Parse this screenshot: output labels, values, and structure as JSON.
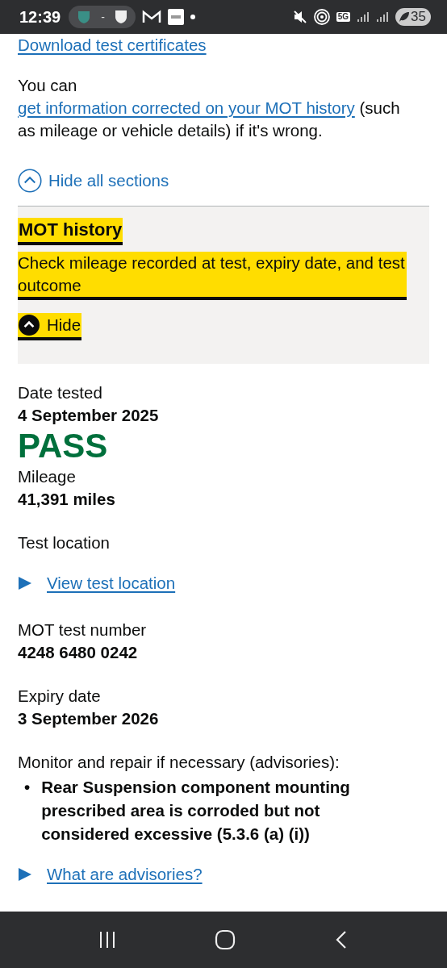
{
  "status_bar": {
    "time": "12:39",
    "separator": "-",
    "network": "5G",
    "battery": "35"
  },
  "download_link": "Download test certificates",
  "intro": {
    "before": "You can ",
    "link": "get information corrected on your MOT history",
    "after": " (such as mileage or vehicle details) if it's wrong."
  },
  "toggle_all": {
    "label": "Hide all sections",
    "expanded": true
  },
  "section": {
    "title": "MOT history",
    "summary": "Check mileage recorded at test, expiry date, and test outcome",
    "toggle": "Hide",
    "focused": true,
    "expanded": true
  },
  "test": {
    "date_label": "Date tested",
    "date": "4 September 2025",
    "result": "PASS",
    "mileage_label": "Mileage",
    "mileage": "41,391 miles",
    "location_label": "Test location",
    "location_link": "View test location",
    "number_label": "MOT test number",
    "number": "4248 6480 0242",
    "expiry_label": "Expiry date",
    "expiry": "3 September 2026",
    "advisories_label": "Monitor and repair if necessary (advisories):",
    "advisories": [
      {
        "bullet": "•",
        "text": "Rear Suspension component mounting prescribed area is corroded but not considered excessive (5.3.6 (a) (i))"
      }
    ],
    "advisories_link": "What are advisories?"
  }
}
